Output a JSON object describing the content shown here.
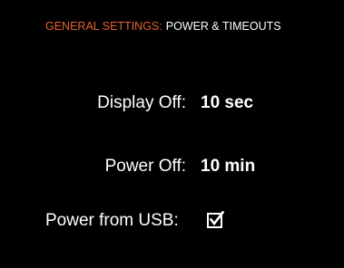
{
  "header": {
    "section": "GENERAL SETTINGS:",
    "page": "POWER & TIMEOUTS"
  },
  "settings": {
    "display_off": {
      "label": "Display Off:",
      "value": "10 sec"
    },
    "power_off": {
      "label": "Power Off:",
      "value": "10 min"
    },
    "power_from_usb": {
      "label": "Power from USB:",
      "checked": true
    }
  },
  "colors": {
    "background": "#000000",
    "accent": "#e8622c",
    "text": "#ffffff"
  },
  "icons": {
    "usb_checkbox": "checkbox-checked-icon"
  }
}
